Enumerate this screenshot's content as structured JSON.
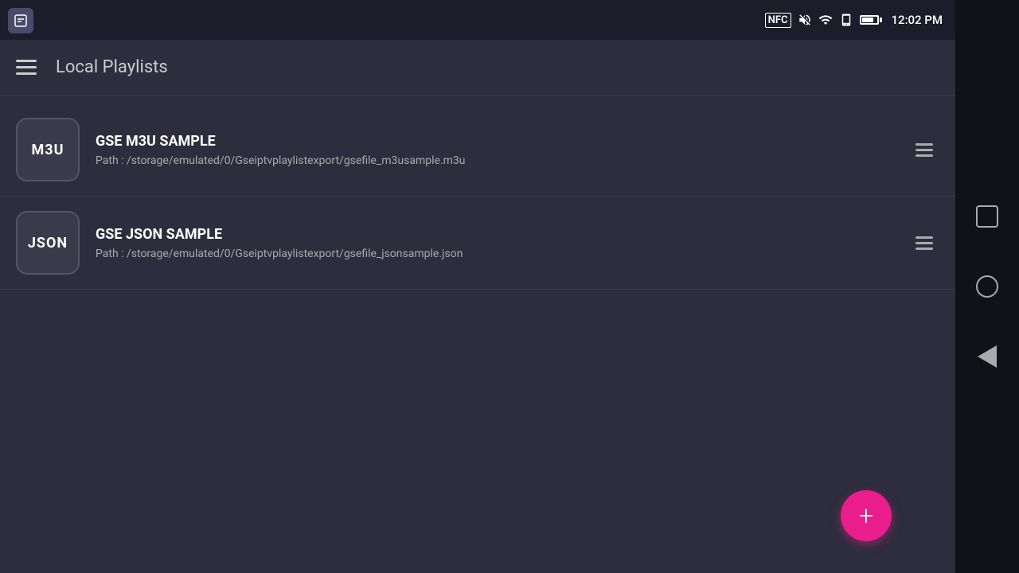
{
  "statusBar": {
    "time": "12:02 PM",
    "icons": [
      "NFC",
      "mute",
      "wifi",
      "phone",
      "battery"
    ]
  },
  "toolbar": {
    "title": "Local Playlists",
    "menuIcon": "hamburger"
  },
  "playlists": [
    {
      "id": "m3u",
      "iconLabel": "M3U",
      "name": "GSE M3U SAMPLE",
      "path": "Path : /storage/emulated/0/Gseiptvplaylistexport/gsefile_m3usample.m3u"
    },
    {
      "id": "json",
      "iconLabel": "JSON",
      "name": "GSE JSON SAMPLE",
      "path": "Path : /storage/emulated/0/Gseiptvplaylistexport/gsefile_jsonsample.json"
    }
  ],
  "fab": {
    "label": "+",
    "color": "#e91e8c"
  },
  "navBar": {
    "buttons": [
      "square",
      "circle",
      "triangle-back"
    ]
  }
}
